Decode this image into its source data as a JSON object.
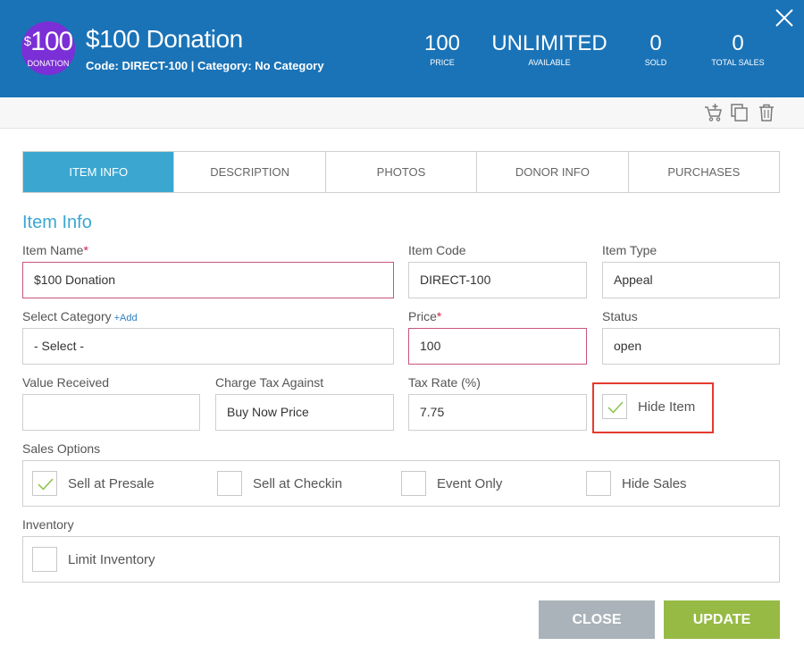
{
  "header": {
    "avatar_amount": "100",
    "avatar_dollar": "$",
    "avatar_sub": "DONATION",
    "title": "$100 Donation",
    "subtitle": "Code: DIRECT-100 | Category: No Category",
    "stats": [
      {
        "value": "100",
        "label": "PRICE"
      },
      {
        "value": "UNLIMITED",
        "label": "AVAILABLE"
      },
      {
        "value": "0",
        "label": "SOLD"
      },
      {
        "value": "0",
        "label": "TOTAL SALES"
      }
    ]
  },
  "tabs": [
    "ITEM INFO",
    "DESCRIPTION",
    "PHOTOS",
    "DONOR INFO",
    "PURCHASES"
  ],
  "section_title": "Item Info",
  "form": {
    "item_name": {
      "label": "Item Name",
      "required": "*",
      "value": "$100 Donation"
    },
    "item_code": {
      "label": "Item Code",
      "value": "DIRECT-100"
    },
    "item_type": {
      "label": "Item Type",
      "value": "Appeal"
    },
    "category": {
      "label": "Select Category",
      "add": "+Add",
      "value": "- Select -"
    },
    "price": {
      "label": "Price",
      "required": "*",
      "value": "100"
    },
    "status": {
      "label": "Status",
      "value": "open"
    },
    "value_received": {
      "label": "Value Received",
      "value": ""
    },
    "charge_tax": {
      "label": "Charge Tax Against",
      "value": "Buy Now Price"
    },
    "tax_rate": {
      "label": "Tax Rate (%)",
      "value": "7.75"
    },
    "hide_item": {
      "label": "Hide Item",
      "checked": true
    }
  },
  "sales_options": {
    "label": "Sales Options",
    "items": [
      {
        "label": "Sell at Presale",
        "checked": true
      },
      {
        "label": "Sell at Checkin",
        "checked": false
      },
      {
        "label": "Event Only",
        "checked": false
      },
      {
        "label": "Hide Sales",
        "checked": false
      }
    ]
  },
  "inventory": {
    "label": "Inventory",
    "limit_label": "Limit Inventory",
    "checked": false
  },
  "buttons": {
    "close": "CLOSE",
    "update": "UPDATE"
  },
  "colors": {
    "header_bg": "#1a73b7",
    "avatar_bg": "#7b2fd6",
    "tab_active": "#3ba7d1",
    "required": "#d0234d",
    "check": "#8bc34a",
    "highlight": "#e53a2e",
    "close_btn": "#aab3b9",
    "update_btn": "#97ba45"
  }
}
